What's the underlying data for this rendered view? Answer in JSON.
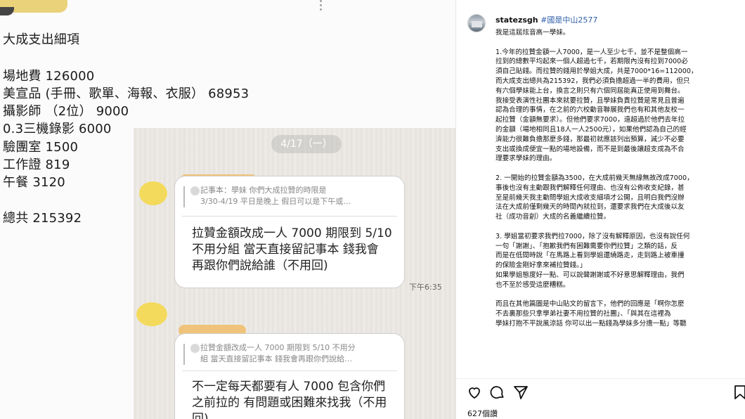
{
  "left": {
    "title": "大成支出細項",
    "items": [
      "場地費 126000",
      "美宣品 (手冊、歌單、海報、衣服）  68953",
      "攝影師 （2位） 9000",
      "0.3三機錄影 6000",
      "驗團室 1500",
      "工作證 819",
      "午餐 3120"
    ],
    "total": "總共 215392"
  },
  "chat": {
    "date": "4/17（一）",
    "bubble1": {
      "quote": [
        "記事本：學妹 你們大成拉贊的時限是",
        "3/30-4/19 平日是晚上 假日可以是下午或…"
      ],
      "lines": [
        "拉贊金額改成一人 7000 期限到 5/10",
        "不用分組 當天直接留記事本 錢我會",
        "再跟你們說給誰（不用回)"
      ],
      "time": "下午6:35"
    },
    "bubble2": {
      "quote": [
        "拉贊金額改成一人 7000 期限到 5/10 不用分",
        "組 當天直接留記事本 錢我會再跟你們說給…"
      ],
      "lines": [
        "不一定每天都要有人 7000 包含你們",
        "之前拉的 有問題或困難來找我（不用",
        "回)"
      ]
    }
  },
  "post": {
    "username": "statezsgh",
    "hashtag": "#國是中山2577",
    "caption": [
      "我是這屆炫音高一學妹。",
      "",
      "1.今年的拉贊金額一人7000，是一人至少七千，並不是整個高一",
      "拉到的總數平均起來一個人超過七千，若期限內沒有拉到7000必",
      "須自己貼錢。而拉贊的錢用於學姐大成，共是7000*16=112000，",
      "而大成支出總共為215392，我們必須負擔超過一半的費用，但只",
      "有六個學妹能上台，換言之則只有六個同屆能真正使用到舞台。",
      "我接受表演性社團本來就要拉贊，且學妹負責拉贊是常見且普遍",
      "認為合理的事情，在之前的六校動音聯展我們也有和其他友校一",
      "起拉贊（金額無要求）。但他們要求7000，遠超過於他們去年拉",
      "的金額（場地相同且18人一人2500元），如果他們認為自己的經",
      "濟能力很難負擔那麼多錢，那最初就應該列出預算，減少不必要",
      "支出或換成便宜一點的場地設備，而不是到最後讓超支成為不合",
      "理要求學妹的理由。",
      "",
      "2. 一開始的拉贊金額為3500，在大成前幾天無緣無故改成7000，",
      "事後也沒有主動跟我們解釋任何理由、也沒有公佈收支紀錄，甚",
      "至是前幾天我主動問學姐大成收支細項才公開，且明白我們沒辦",
      "法在大成前僅剩幾天的時間內就拉到，還要求我們在大成後以友",
      "社（成功音創）大成的名義繼續拉贊。",
      "",
      "3. 學姐當初要求我們拉7000，除了沒有解釋原因，也沒有說任何",
      "一句「謝謝」、「抱歉我們有困難需要你們拉贊」之類的話，反",
      "而是在低間時說「在馬路上看到學姐還繞路走，走到路上被車撞",
      "的保險金剛好拿來補拉贊錢。」",
      "如果學姐態度好一點、可以說聲謝謝或不好意思解釋理由，我們",
      "也不至於感受這麼糟糕。",
      "",
      "而且在其他篇圖是中山貼文的留言下，他們的回應是「啊你怎麼",
      "不去裏那些只拿學弟社妻不用拉贊的社團」、「與其在這裡為",
      "學妹打抱不平說風涼話 你可以出一點錢為學妹多分擔一點」等聽"
    ],
    "likes": "627個讚",
    "icons": [
      "heart-icon",
      "comment-icon",
      "share-icon",
      "bookmark-icon"
    ]
  }
}
